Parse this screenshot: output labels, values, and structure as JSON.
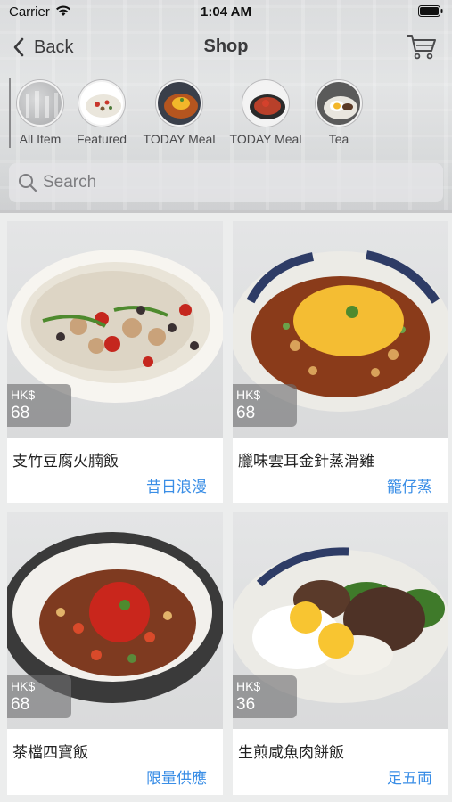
{
  "status": {
    "carrier": "Carrier",
    "time": "1:04 AM"
  },
  "nav": {
    "back_label": "Back",
    "title": "Shop",
    "cart_icon": "cart-icon"
  },
  "categories": [
    {
      "label": "All Item"
    },
    {
      "label": "Featured"
    },
    {
      "label": "TODAY Meal"
    },
    {
      "label": "TODAY Meal"
    },
    {
      "label": "Tea"
    }
  ],
  "search": {
    "placeholder": "Search"
  },
  "products": [
    {
      "currency": "HK$",
      "price": "68",
      "name": "支竹豆腐火腩飯",
      "tag": "昔日浪漫"
    },
    {
      "currency": "HK$",
      "price": "68",
      "name": "臘味雲耳金針蒸滑雞",
      "tag": "籠仔蒸"
    },
    {
      "currency": "HK$",
      "price": "68",
      "name": "茶檔四寶飯",
      "tag": "限量供應"
    },
    {
      "currency": "HK$",
      "price": "36",
      "name": "生煎咸魚肉餅飯",
      "tag": "足五両"
    }
  ],
  "colors": {
    "accent": "#3a8ee6",
    "price_badge": "#6e6e70"
  }
}
